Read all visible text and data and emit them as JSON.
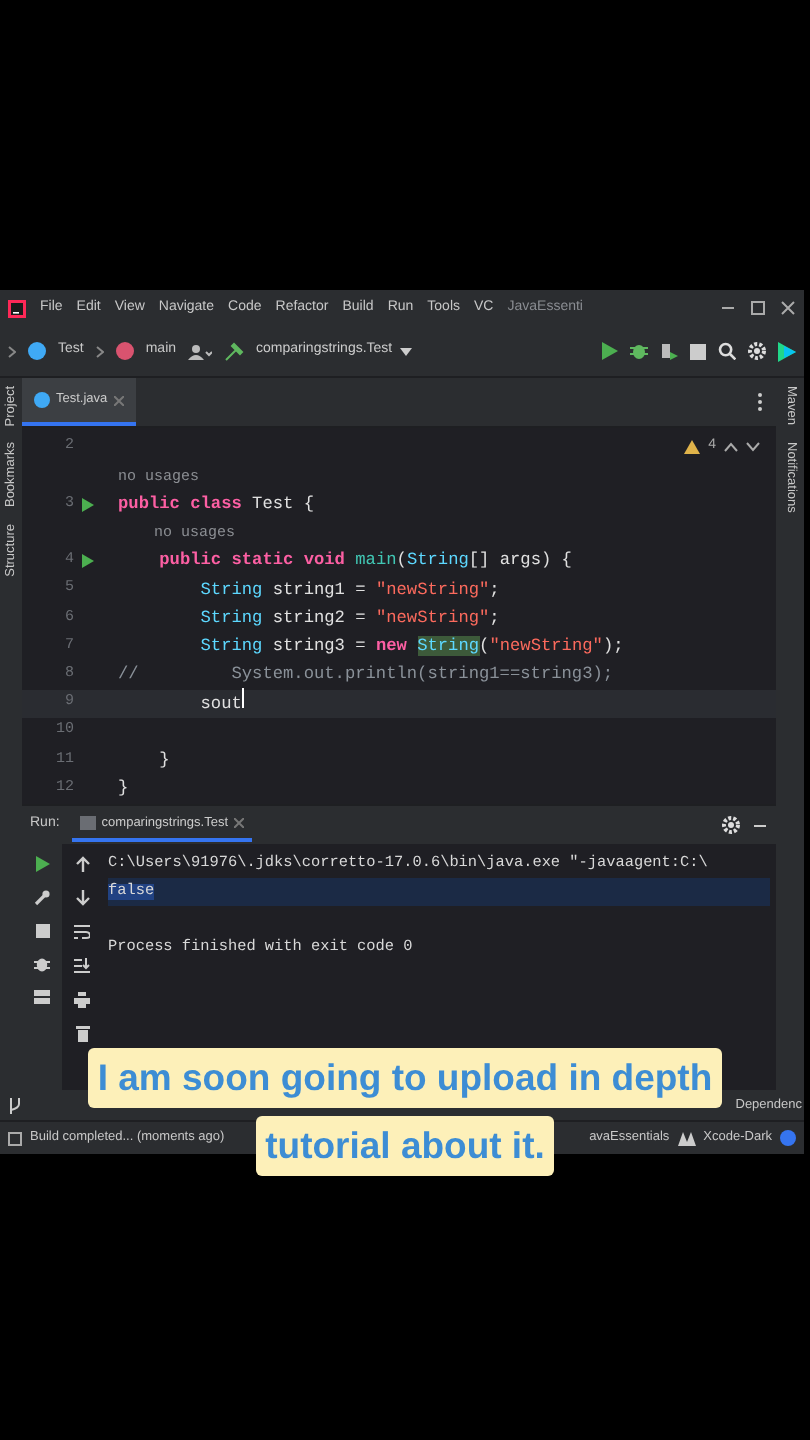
{
  "menu_bar": {
    "items": [
      "File",
      "Edit",
      "View",
      "Navigate",
      "Code",
      "Refactor",
      "Build",
      "Run",
      "Tools",
      "VC"
    ],
    "project": "JavaEssenti"
  },
  "toolbar": {
    "breadcrumbs": [
      "Test",
      "main"
    ],
    "run_config": "comparingstrings.Test"
  },
  "side_tabs": {
    "left": [
      "Project",
      "Bookmarks",
      "Structure"
    ],
    "right": [
      "Maven",
      "Notifications"
    ]
  },
  "editor_tabs": [
    {
      "label": "Test.java",
      "selected": true
    }
  ],
  "inspections": {
    "warnings": "4"
  },
  "code_lines": [
    {
      "number": "2",
      "run": false,
      "current": false
    },
    {
      "run": false,
      "current": false,
      "tokens": [
        {
          "text": "no usages",
          "kind": "hint"
        }
      ]
    },
    {
      "number": "3",
      "run": true,
      "current": false,
      "tokens": [
        {
          "text": "public class ",
          "kind": "keyword"
        },
        {
          "text": "Test {",
          "kind": "plain"
        }
      ]
    },
    {
      "run": false,
      "current": false,
      "tokens": [
        {
          "text": "    no usages",
          "kind": "hint"
        }
      ]
    },
    {
      "number": "4",
      "run": true,
      "current": false,
      "tokens": [
        {
          "text": "    public static void ",
          "kind": "keyword"
        },
        {
          "text": "main",
          "kind": "declaration"
        },
        {
          "text": "(",
          "kind": "plain"
        },
        {
          "text": "String",
          "kind": "type"
        },
        {
          "text": "[] args) {",
          "kind": "plain"
        }
      ]
    },
    {
      "number": "5",
      "run": false,
      "current": false,
      "tokens": [
        {
          "text": "        String",
          "kind": "type"
        },
        {
          "text": " string1 = ",
          "kind": "plain"
        },
        {
          "text": "\"newString\"",
          "kind": "string"
        },
        {
          "text": ";",
          "kind": "plain"
        }
      ]
    },
    {
      "number": "6",
      "run": false,
      "current": false,
      "tokens": [
        {
          "text": "        String",
          "kind": "type"
        },
        {
          "text": " string2 = ",
          "kind": "plain"
        },
        {
          "text": "\"newString\"",
          "kind": "string"
        },
        {
          "text": ";",
          "kind": "plain"
        }
      ]
    },
    {
      "number": "7",
      "run": false,
      "current": false,
      "tokens": [
        {
          "text": "        String",
          "kind": "type"
        },
        {
          "text": " string3 = ",
          "kind": "plain"
        },
        {
          "text": "new ",
          "kind": "keyword"
        },
        {
          "text": "String",
          "kind": "marked"
        },
        {
          "text": "(",
          "kind": "plain"
        },
        {
          "text": "\"newString\"",
          "kind": "string"
        },
        {
          "text": ");",
          "kind": "plain"
        }
      ]
    },
    {
      "number": "8",
      "run": false,
      "current": false,
      "tokens": [
        {
          "text": "//         System.out.println(string1==string3);",
          "kind": "comment"
        }
      ]
    },
    {
      "number": "9",
      "run": false,
      "current": true,
      "tokens": [
        {
          "text": "        sout",
          "kind": "plain"
        }
      ]
    },
    {
      "number": "10",
      "run": false,
      "current": false
    },
    {
      "number": "11",
      "run": false,
      "current": false,
      "tokens": [
        {
          "text": "    }",
          "kind": "plain"
        }
      ]
    },
    {
      "number": "12",
      "run": false,
      "current": false,
      "tokens": [
        {
          "text": "}",
          "kind": "plain"
        }
      ]
    }
  ],
  "run_panel": {
    "title": "Run:",
    "tab": "comparingstrings.Test",
    "console": [
      {
        "text": "C:\\Users\\91976\\.jdks\\corretto-17.0.6\\bin\\java.exe \"-javaagent:C:\\",
        "selected": false
      },
      {
        "text": "false",
        "selected": true
      },
      {
        "selected": false
      },
      {
        "text": "Process finished with exit code 0",
        "selected": false
      }
    ]
  },
  "tool_window_bar": {
    "right_item": "Dependenc"
  },
  "status_bar": {
    "message": "Build completed... (moments ago)",
    "project": "avaEssentials",
    "theme": "Xcode-Dark"
  },
  "caption": {
    "lines": [
      "I am soon going to upload in depth",
      "tutorial about it."
    ]
  }
}
